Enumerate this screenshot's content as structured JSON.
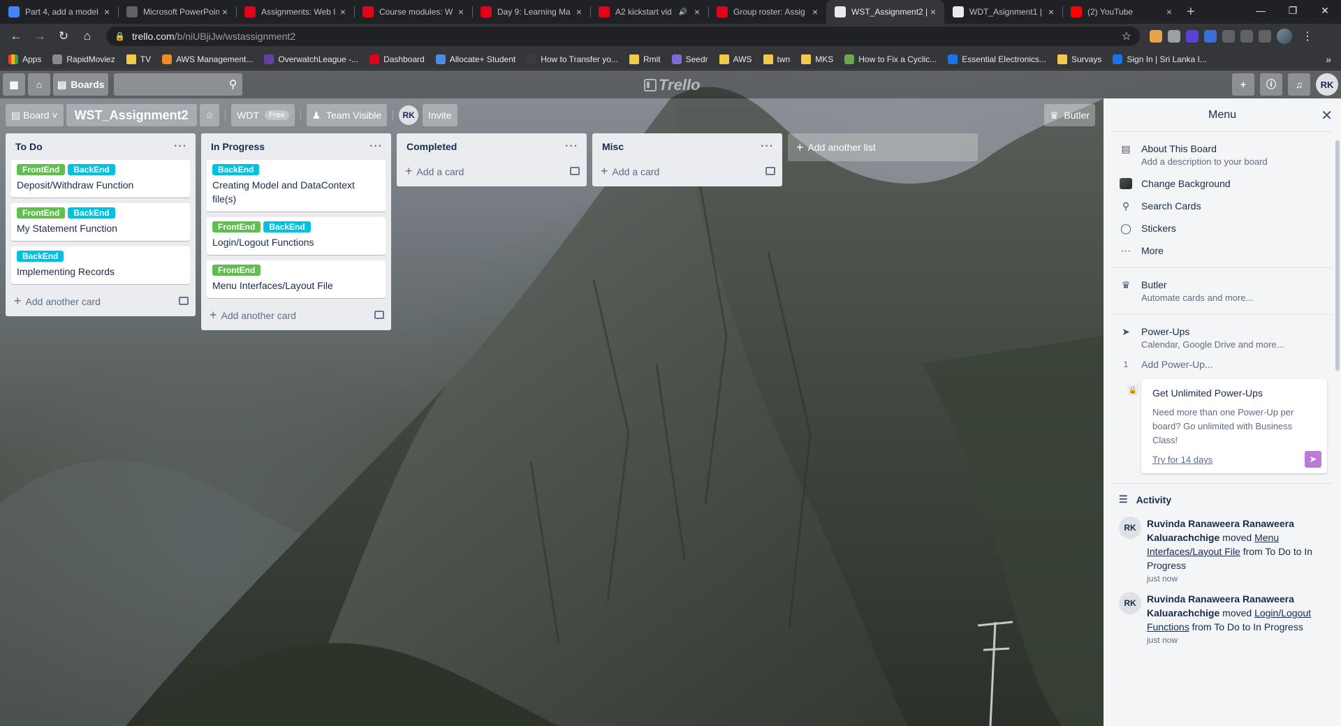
{
  "browser": {
    "tabs": [
      {
        "title": "Part 4, add a model",
        "favicon": "#4285f4",
        "active": false
      },
      {
        "title": "Microsoft PowerPoint",
        "favicon": "#5f6368",
        "active": false
      },
      {
        "title": "Assignments: Web I",
        "favicon": "#e3001b",
        "active": false
      },
      {
        "title": "Course modules: W",
        "favicon": "#e3001b",
        "active": false
      },
      {
        "title": "Day 9: Learning Ma",
        "favicon": "#e3001b",
        "active": false
      },
      {
        "title": "A2 kickstart vid",
        "favicon": "#e3001b",
        "active": false,
        "audio": true
      },
      {
        "title": "Group roster: Assig",
        "favicon": "#e3001b",
        "active": false
      },
      {
        "title": "WST_Assignment2 |",
        "favicon": "#ffffff",
        "active": true
      },
      {
        "title": "WDT_Asignment1 |",
        "favicon": "#ffffff",
        "active": false
      },
      {
        "title": "(2) YouTube",
        "favicon": "#ff0000",
        "active": false
      }
    ],
    "url_host": "trello.com",
    "url_path": "/b/niUBjiJw/wstassignment2",
    "bookmarks": [
      {
        "label": "Apps",
        "type": "apps"
      },
      {
        "label": "RapidMoviez",
        "type": "site",
        "color": "#8a8a8a"
      },
      {
        "label": "TV",
        "type": "folder"
      },
      {
        "label": "AWS Management...",
        "type": "site",
        "color": "#f08a24"
      },
      {
        "label": "OverwatchLeague -...",
        "type": "site",
        "color": "#6441a5"
      },
      {
        "label": "Dashboard",
        "type": "site",
        "color": "#e3001b"
      },
      {
        "label": "Allocate+ Student",
        "type": "site",
        "color": "#4a90e2"
      },
      {
        "label": "How to Transfer yo...",
        "type": "site",
        "color": "#3c3c3c"
      },
      {
        "label": "Rmit",
        "type": "folder"
      },
      {
        "label": "Seedr",
        "type": "site",
        "color": "#7d6bd6"
      },
      {
        "label": "AWS",
        "type": "folder"
      },
      {
        "label": "twn",
        "type": "folder"
      },
      {
        "label": "MKS",
        "type": "folder"
      },
      {
        "label": "How to Fix a Cyclic...",
        "type": "site",
        "color": "#6aa84f"
      },
      {
        "label": "Essential Electronics...",
        "type": "site",
        "color": "#1a73e8"
      },
      {
        "label": "Survays",
        "type": "folder"
      },
      {
        "label": "Sign In | Sri Lanka I...",
        "type": "site",
        "color": "#1a73e8"
      }
    ]
  },
  "trello_header": {
    "boards_label": "Boards",
    "logo_text": "Trello",
    "avatar": "RK"
  },
  "board": {
    "view_label": "Board",
    "title": "WST_Assignment2",
    "team": "WDT",
    "team_plan": "Free",
    "visibility": "Team Visible",
    "member": "RK",
    "invite_label": "Invite",
    "butler_label": "Butler"
  },
  "lists": [
    {
      "name": "To Do",
      "add_label": "Add another card",
      "cards": [
        {
          "labels": [
            "FrontEnd",
            "BackEnd"
          ],
          "title": "Deposit/Withdraw Function"
        },
        {
          "labels": [
            "FrontEnd",
            "BackEnd"
          ],
          "title": "My Statement Function"
        },
        {
          "labels": [
            "BackEnd"
          ],
          "title": "Implementing Records"
        }
      ]
    },
    {
      "name": "In Progress",
      "add_label": "Add another card",
      "cards": [
        {
          "labels": [
            "BackEnd"
          ],
          "title": "Creating Model and DataContext file(s)"
        },
        {
          "labels": [
            "FrontEnd",
            "BackEnd"
          ],
          "title": "Login/Logout Functions"
        },
        {
          "labels": [
            "FrontEnd"
          ],
          "title": "Menu Interfaces/Layout File"
        }
      ]
    },
    {
      "name": "Completed",
      "add_label": "Add a card",
      "cards": []
    },
    {
      "name": "Misc",
      "add_label": "Add a card",
      "cards": []
    }
  ],
  "label_colors": {
    "FrontEnd": "#61bd4f",
    "BackEnd": "#00c2e0"
  },
  "add_list_label": "Add another list",
  "menu": {
    "title": "Menu",
    "about_title": "About This Board",
    "about_sub": "Add a description to your board",
    "change_bg": "Change Background",
    "search_cards": "Search Cards",
    "stickers": "Stickers",
    "more": "More",
    "butler_title": "Butler",
    "butler_sub": "Automate cards and more...",
    "powerups_title": "Power-Ups",
    "powerups_sub": "Calendar, Google Drive and more...",
    "powerups_count": "1",
    "add_powerup": "Add Power-Up...",
    "promo_title": "Get Unlimited Power-Ups",
    "promo_body": "Need more than one Power-Up per board? Go unlimited with Business Class!",
    "promo_link": "Try for 14 days",
    "activity_title": "Activity",
    "activity": [
      {
        "avatar": "RK",
        "user": "Ruvinda Ranaweera Ranaweera Kaluarachchige",
        "verb": "moved",
        "card": "Menu Interfaces/Layout File",
        "from_to": "from To Do to In Progress",
        "time": "just now"
      },
      {
        "avatar": "RK",
        "user": "Ruvinda Ranaweera Ranaweera Kaluarachchige",
        "verb": "moved",
        "card": "Login/Logout Functions",
        "from_to": "from To Do to In Progress",
        "time": "just now"
      }
    ]
  }
}
